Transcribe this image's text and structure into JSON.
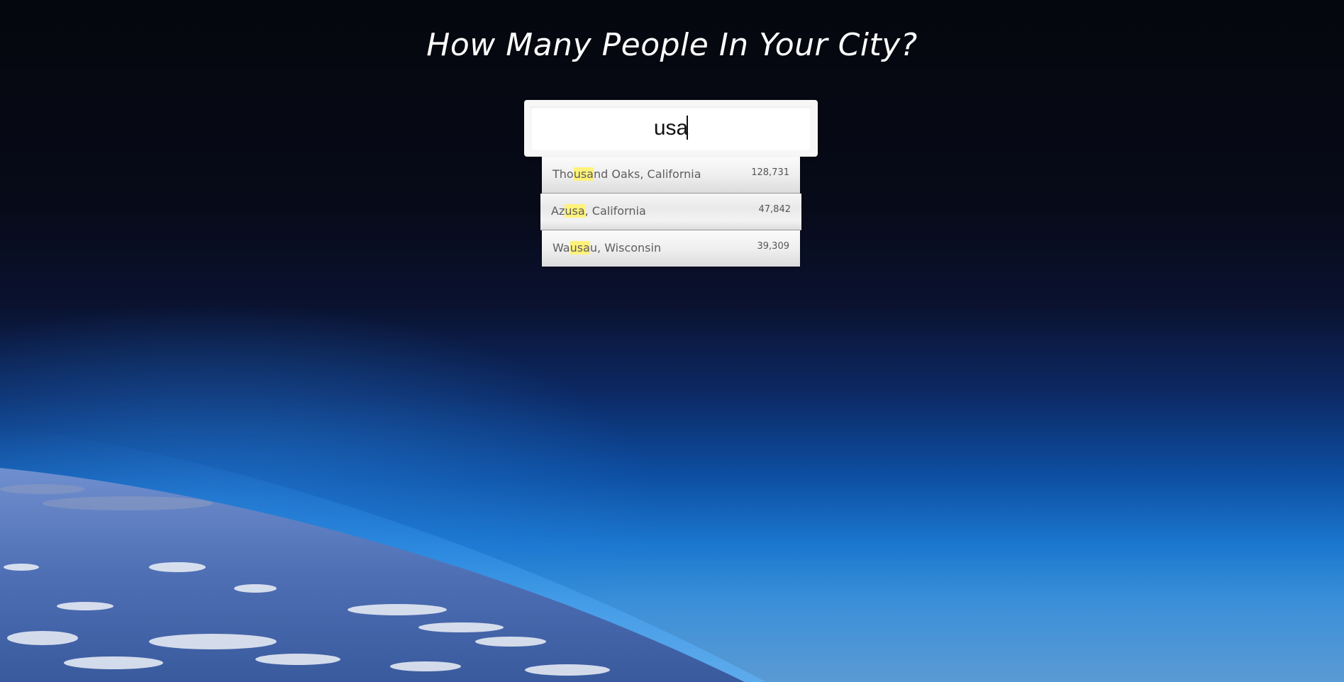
{
  "page": {
    "title": "How Many People In Your City?"
  },
  "search": {
    "value": "usa",
    "query_highlight_color": "#fff27a"
  },
  "suggestions": [
    {
      "prefix": "Tho",
      "match": "usa",
      "suffix": "nd Oaks, California",
      "population": "128,731"
    },
    {
      "prefix": "Az",
      "match": "usa",
      "suffix": ", California",
      "population": "47,842"
    },
    {
      "prefix": "Wa",
      "match": "usa",
      "suffix": "u, Wisconsin",
      "population": "39,309"
    }
  ],
  "colors": {
    "space": "#05070f",
    "atmosphere": "#1b78cf",
    "panel": "#f7f7f7"
  }
}
